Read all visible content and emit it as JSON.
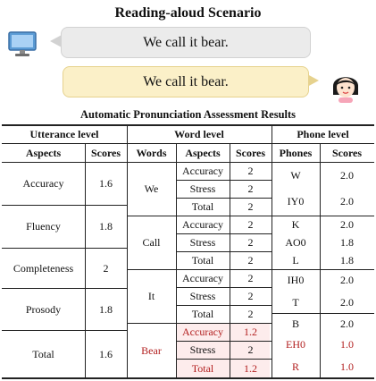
{
  "title": "Reading-aloud Scenario",
  "dialog": {
    "system_message": "We call it bear.",
    "user_message": "We call it bear.",
    "system_icon": "computer-monitor-icon",
    "user_icon": "girl-avatar-icon"
  },
  "table": {
    "title": "Automatic Pronunciation Assessment Results",
    "group_headers": {
      "utterance": "Utterance level",
      "word": "Word level",
      "phone": "Phone level"
    },
    "col_headers": {
      "u_aspects": "Aspects",
      "u_scores": "Scores",
      "w_words": "Words",
      "w_aspects": "Aspects",
      "w_scores": "Scores",
      "p_phones": "Phones",
      "p_scores": "Scores"
    },
    "utterance_rows": [
      {
        "aspect": "Accuracy",
        "score": "1.6"
      },
      {
        "aspect": "Fluency",
        "score": "1.8"
      },
      {
        "aspect": "Completeness",
        "score": "2"
      },
      {
        "aspect": "Prosody",
        "score": "1.8"
      },
      {
        "aspect": "Total",
        "score": "1.6"
      }
    ],
    "words": [
      {
        "word": "We",
        "rows": [
          {
            "aspect": "Accuracy",
            "score": "2"
          },
          {
            "aspect": "Stress",
            "score": "2"
          },
          {
            "aspect": "Total",
            "score": "2"
          }
        ]
      },
      {
        "word": "Call",
        "rows": [
          {
            "aspect": "Accuracy",
            "score": "2"
          },
          {
            "aspect": "Stress",
            "score": "2"
          },
          {
            "aspect": "Total",
            "score": "2"
          }
        ]
      },
      {
        "word": "It",
        "rows": [
          {
            "aspect": "Accuracy",
            "score": "2"
          },
          {
            "aspect": "Stress",
            "score": "2"
          },
          {
            "aspect": "Total",
            "score": "2"
          }
        ]
      },
      {
        "word": "Bear",
        "rows": [
          {
            "aspect": "Accuracy",
            "score": "1.2"
          },
          {
            "aspect": "Stress",
            "score": "2"
          },
          {
            "aspect": "Total",
            "score": "1.2"
          }
        ]
      }
    ],
    "phones": [
      {
        "phone": "W",
        "score": "2.0"
      },
      {
        "phone": "IY0",
        "score": "2.0"
      },
      {
        "phone": "K",
        "score": "2.0"
      },
      {
        "phone": "AO0",
        "score": "1.8"
      },
      {
        "phone": "L",
        "score": "1.8"
      },
      {
        "phone": "IH0",
        "score": "2.0"
      },
      {
        "phone": "T",
        "score": "2.0"
      },
      {
        "phone": "B",
        "score": "2.0"
      },
      {
        "phone": "EH0",
        "score": "1.0"
      },
      {
        "phone": "R",
        "score": "1.0"
      }
    ],
    "colors": {
      "error_red": "#b21e1e",
      "error_bg": "#fdecec",
      "user_bubble": "#fbf0c8",
      "system_bubble": "#ebebeb"
    }
  }
}
